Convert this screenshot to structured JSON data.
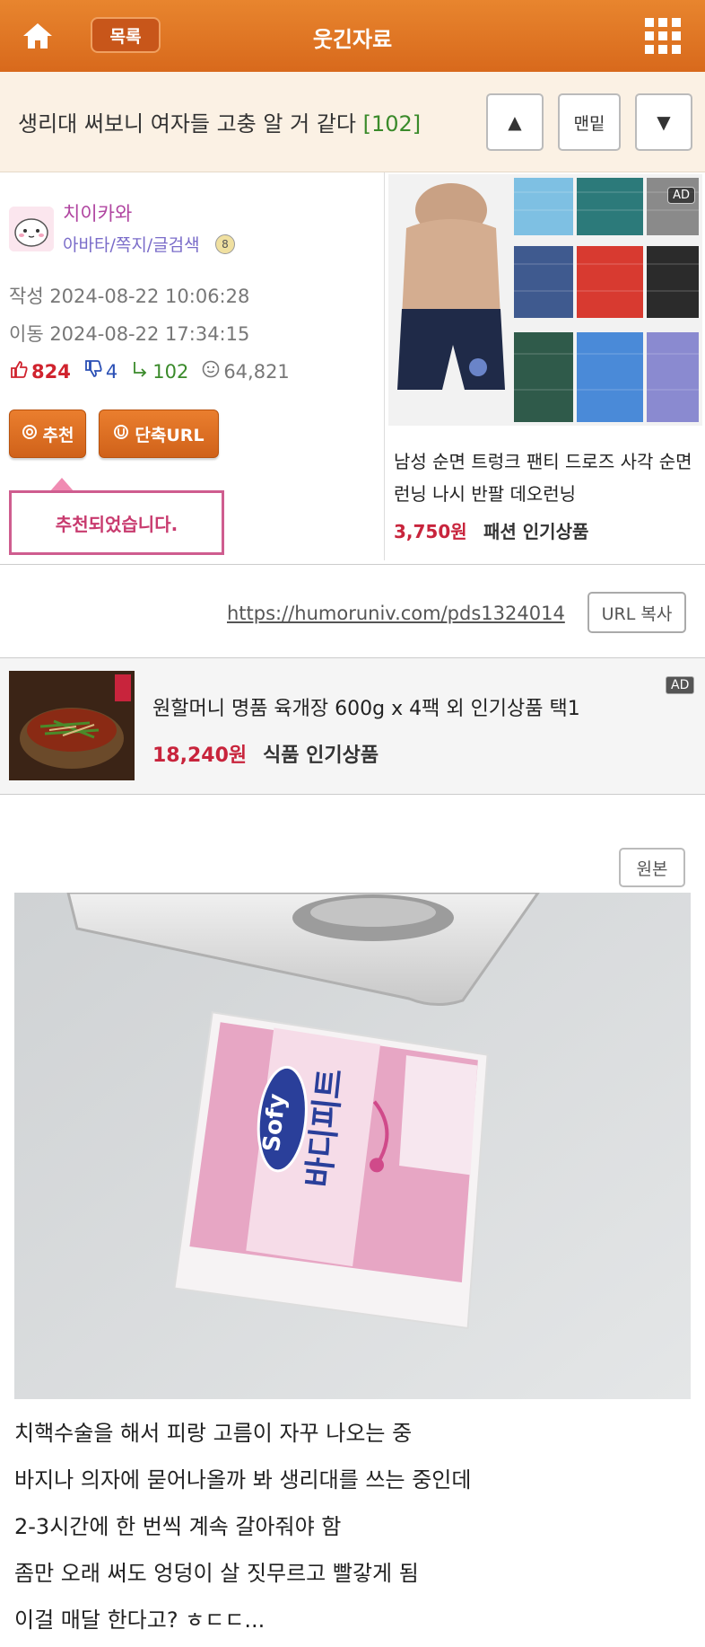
{
  "header": {
    "list_label": "목록",
    "board_title": "웃긴자료",
    "home_icon": "home-icon",
    "menu_icon": "grid-menu-icon"
  },
  "post": {
    "title": "생리대 써보니 여자들 고충 알 거 같다",
    "comment_count": "[102]",
    "nav_up": "▲",
    "nav_bottom": "맨밑",
    "nav_down": "▼"
  },
  "author": {
    "nickname": "치이카와",
    "links": "아바타/쪽지/글검색",
    "level": "8",
    "written": "작성 2024-08-22 10:06:28",
    "moved": "이동 2024-08-22 17:34:15"
  },
  "stats": {
    "likes": "824",
    "dislikes": "4",
    "comments": "102",
    "views": "64,821"
  },
  "actions": {
    "recommend": "추천",
    "short_url": "단축URL",
    "recommended_notice": "추천되었습니다."
  },
  "right_ad": {
    "badge": "AD",
    "name": "남성 순면 트렁크 팬티 드로즈 사각 순면 런닝 나시 반팔 데오런닝",
    "price": "3,750원",
    "category": "패션 인기상품"
  },
  "url": {
    "link": "https://humoruniv.com/pds1324014",
    "copy_label": "URL 복사"
  },
  "food_ad": {
    "badge": "AD",
    "name": "원할머니 명품 육개장 600g x 4팩 외 인기상품 택1",
    "price": "18,240원",
    "category": "식품 인기상품"
  },
  "content": {
    "original_label": "원본",
    "package_brand": "Sofy",
    "package_product": "바디피트",
    "lines": [
      "치핵수술을 해서 피랑 고름이 자꾸 나오는 중",
      "바지나 의자에 묻어나올까 봐 생리대를 쓰는 중인데",
      "2-3시간에 한 번씩 계속 갈아줘야 함",
      "좀만 오래 써도 엉덩이 살 짓무르고 빨갛게 됨",
      "이걸 매달 한다고? ㅎㄷㄷ..."
    ]
  },
  "colors": {
    "header": "#e07a28",
    "title_bg": "#fbf1e4",
    "price": "#c8243c",
    "comment_count": "#3a8a2a"
  }
}
